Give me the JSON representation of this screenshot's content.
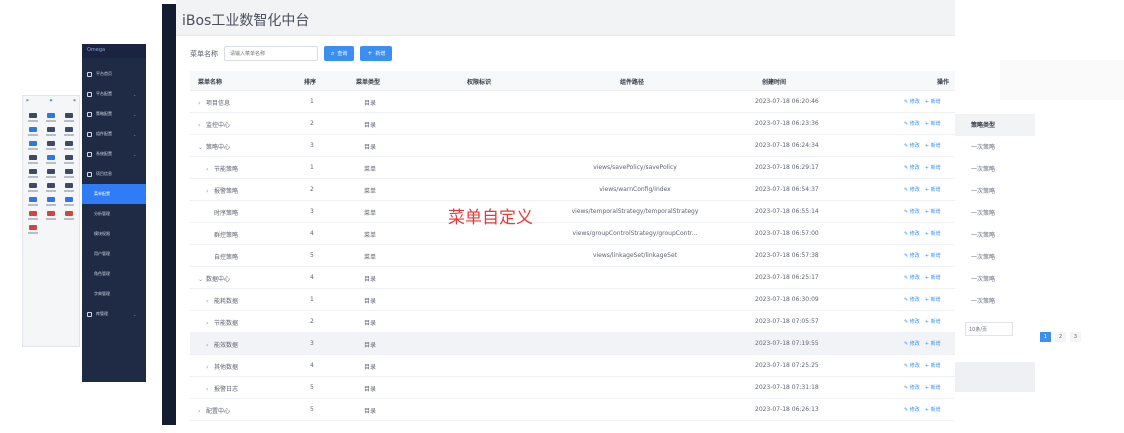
{
  "app": {
    "title": "iBos工业数智化中台"
  },
  "search": {
    "label": "菜单名称",
    "placeholder": "请输入菜单名称",
    "search_button": "查询",
    "add_button": "新增"
  },
  "table": {
    "columns": [
      "菜单名称",
      "排序",
      "菜单类型",
      "权限标识",
      "组件路径",
      "创建时间",
      "操作"
    ],
    "actions": {
      "edit": "修改",
      "add": "新增"
    },
    "rows": [
      {
        "caret": "›",
        "name": "项目信息",
        "order": "1",
        "type": "目录",
        "path": "",
        "time": "2023-07-18 06:20:46"
      },
      {
        "caret": "›",
        "name": "监控中心",
        "order": "2",
        "type": "目录",
        "path": "",
        "time": "2023-07-18 06:23:36"
      },
      {
        "caret": "⌄",
        "name": "策略中心",
        "order": "3",
        "type": "目录",
        "path": "",
        "time": "2023-07-18 06:24:34"
      },
      {
        "caret": "›",
        "name": "节能策略",
        "order": "1",
        "type": "菜单",
        "path": "views/savePolicy/savePolicy",
        "time": "2023-07-18 06:29:17"
      },
      {
        "caret": "›",
        "name": "报警策略",
        "order": "2",
        "type": "菜单",
        "path": "views/warnConfig/index",
        "time": "2023-07-18 06:54:37"
      },
      {
        "caret": "",
        "name": "时序策略",
        "order": "3",
        "type": "菜单",
        "path": "views/temporalStrategy/temporalStrategy",
        "time": "2023-07-18 06:55:14"
      },
      {
        "caret": "",
        "name": "群控策略",
        "order": "4",
        "type": "菜单",
        "path": "views/groupControlStrategy/groupContr...",
        "time": "2023-07-18 06:57:00"
      },
      {
        "caret": "",
        "name": "自控策略",
        "order": "5",
        "type": "菜单",
        "path": "views/linkageSet/linkageSet",
        "time": "2023-07-18 06:57:38"
      },
      {
        "caret": "⌄",
        "name": "数据中心",
        "order": "4",
        "type": "目录",
        "path": "",
        "time": "2023-07-18 06:25:17"
      },
      {
        "caret": "›",
        "name": "能耗数据",
        "order": "1",
        "type": "目录",
        "path": "",
        "time": "2023-07-18 06:30:09"
      },
      {
        "caret": "›",
        "name": "节能数据",
        "order": "2",
        "type": "目录",
        "path": "",
        "time": "2023-07-18 07:05:57"
      },
      {
        "caret": "›",
        "name": "能效数据",
        "order": "3",
        "type": "目录",
        "path": "",
        "time": "2023-07-18 07:19:55"
      },
      {
        "caret": "›",
        "name": "其他数据",
        "order": "4",
        "type": "目录",
        "path": "",
        "time": "2023-07-18 07:25:25"
      },
      {
        "caret": "›",
        "name": "报警日志",
        "order": "5",
        "type": "目录",
        "path": "",
        "time": "2023-07-18 07:31:18"
      },
      {
        "caret": "›",
        "name": "配置中心",
        "order": "5",
        "type": "目录",
        "path": "",
        "time": "2023-07-18 06:26:13"
      }
    ]
  },
  "overlay": {
    "text": "菜单自定义"
  },
  "right_panel": {
    "header": "策略类型",
    "rows": [
      "一次策略",
      "一次策略",
      "一次策略",
      "一次策略",
      "一次策略",
      "一次策略",
      "一次策略",
      "一次策略"
    ],
    "page_size": "10条/页",
    "pages": [
      "1",
      "2",
      "3"
    ]
  },
  "sidebar2": {
    "brand": "Omega",
    "items": [
      "平台首页",
      "平台配置",
      "策略配置",
      "组件配置",
      "系统配置",
      "项目信息",
      "菜单配置",
      "分析管理",
      "模块权限",
      "用户管理",
      "角色管理",
      "字典管理",
      "库管理"
    ]
  }
}
